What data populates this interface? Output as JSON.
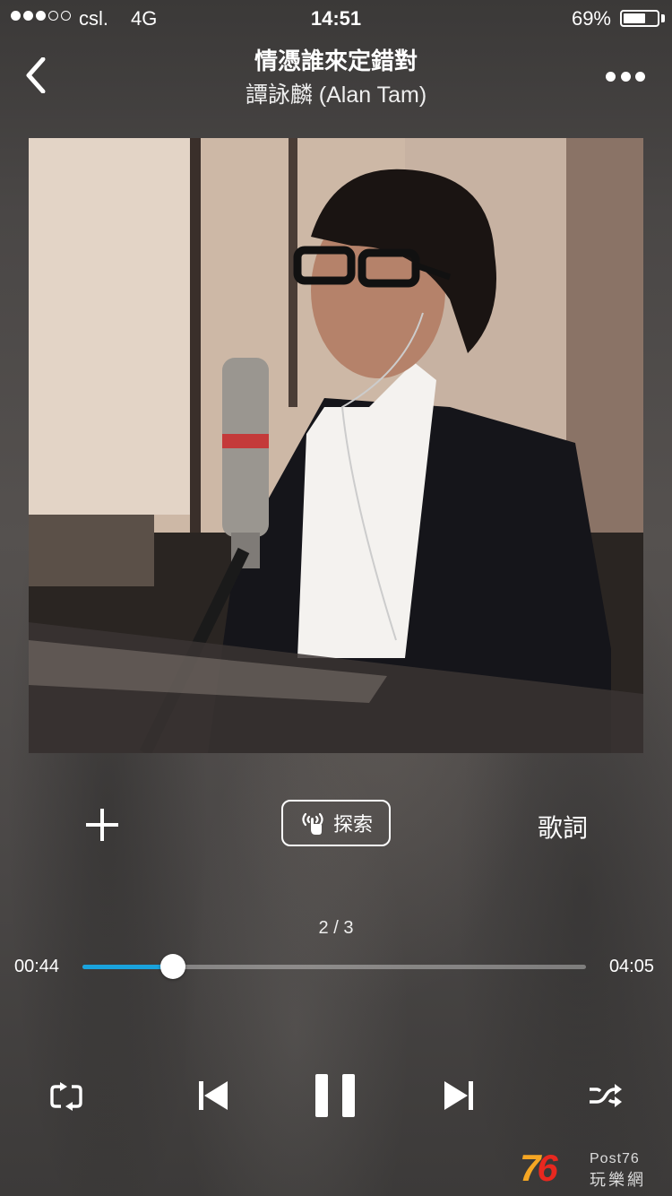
{
  "status_bar": {
    "carrier": "csl.",
    "network": "4G",
    "time": "14:51",
    "battery_percent": "69%",
    "battery_level": 0.69,
    "signal_strength": 3,
    "signal_max": 5
  },
  "header": {
    "title": "情憑誰來定錯對",
    "artist": "譚詠麟 (Alan Tam)",
    "back_icon": "chevron-left-icon",
    "more_icon": "more-dots-icon"
  },
  "actions": {
    "add_icon": "plus-icon",
    "discover_label": "探索",
    "discover_icon": "radio-tap-icon",
    "lyrics_label": "歌詞"
  },
  "progress": {
    "page": "2 / 3",
    "elapsed": "00:44",
    "total": "04:05",
    "fraction": 0.18,
    "accent_color": "#1aa3dd"
  },
  "controls": {
    "repeat_icon": "repeat-icon",
    "previous_icon": "previous-track-icon",
    "pause_icon": "pause-icon",
    "next_icon": "next-track-icon",
    "shuffle_icon": "shuffle-icon"
  },
  "watermark": {
    "number_a": "7",
    "number_b": "6",
    "brand": "Post76",
    "sub": "玩樂網"
  }
}
